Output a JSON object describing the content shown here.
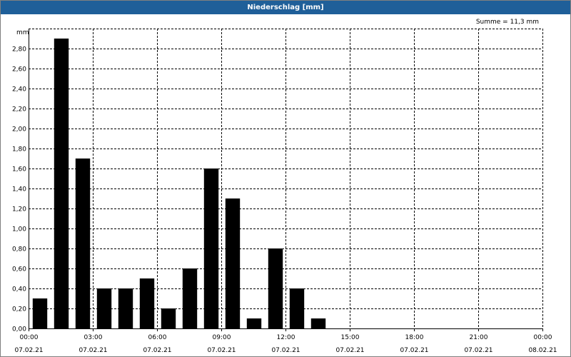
{
  "window": {
    "title": "Niederschlag [mm]"
  },
  "summary_text": "Summe = 11,3 mm",
  "colors": {
    "titlebar": "#1f5f99",
    "bar": "#000000",
    "grid": "#000000"
  },
  "chart_data": {
    "type": "bar",
    "title": "Niederschlag [mm]",
    "ylabel": "mm",
    "xlabel": "",
    "ylim": [
      0,
      3.0
    ],
    "y_ticks": [
      "0,00",
      "0,20",
      "0,40",
      "0,60",
      "0,80",
      "1,00",
      "1,20",
      "1,40",
      "1,60",
      "1,80",
      "2,00",
      "2,20",
      "2,40",
      "2,60",
      "2,80"
    ],
    "y_tick_values": [
      0,
      0.2,
      0.4,
      0.6,
      0.8,
      1.0,
      1.2,
      1.4,
      1.6,
      1.8,
      2.0,
      2.2,
      2.4,
      2.6,
      2.8
    ],
    "x_range_hours": [
      0,
      24
    ],
    "x_ticks": [
      {
        "hour": 0,
        "time": "00:00",
        "date": "07.02.21"
      },
      {
        "hour": 3,
        "time": "03:00",
        "date": "07.02.21"
      },
      {
        "hour": 6,
        "time": "06:00",
        "date": "07.02.21"
      },
      {
        "hour": 9,
        "time": "09:00",
        "date": "07.02.21"
      },
      {
        "hour": 12,
        "time": "12:00",
        "date": "07.02.21"
      },
      {
        "hour": 15,
        "time": "15:00",
        "date": "07.02.21"
      },
      {
        "hour": 18,
        "time": "18:00",
        "date": "07.02.21"
      },
      {
        "hour": 21,
        "time": "21:00",
        "date": "07.02.21"
      },
      {
        "hour": 24,
        "time": "00:00",
        "date": "08.02.21"
      }
    ],
    "interval_hours": 1,
    "bars": [
      {
        "start_hour": 0,
        "value": 0.3
      },
      {
        "start_hour": 1,
        "value": 2.9
      },
      {
        "start_hour": 2,
        "value": 1.7
      },
      {
        "start_hour": 3,
        "value": 0.4
      },
      {
        "start_hour": 4,
        "value": 0.4
      },
      {
        "start_hour": 5,
        "value": 0.5
      },
      {
        "start_hour": 6,
        "value": 0.2
      },
      {
        "start_hour": 7,
        "value": 0.6
      },
      {
        "start_hour": 8,
        "value": 1.6
      },
      {
        "start_hour": 9,
        "value": 1.3
      },
      {
        "start_hour": 10,
        "value": 0.1
      },
      {
        "start_hour": 11,
        "value": 0.8
      },
      {
        "start_hour": 12,
        "value": 0.4
      },
      {
        "start_hour": 13,
        "value": 0.1
      }
    ],
    "grid": true,
    "legend": "none"
  }
}
